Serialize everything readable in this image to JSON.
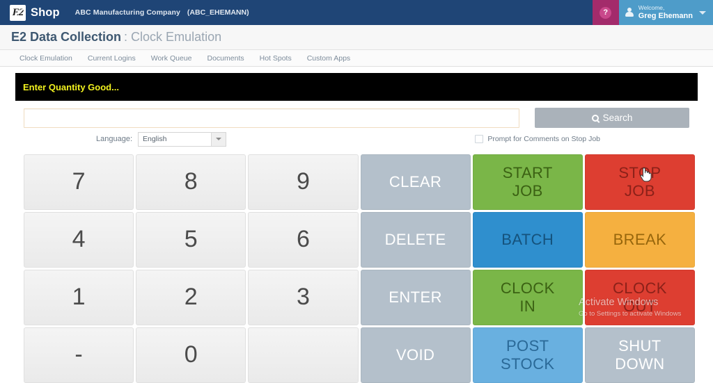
{
  "topbar": {
    "logo_text": "E2",
    "logo_icon": "e2-shop-logo-icon",
    "brand": "Shop",
    "company": "ABC Manufacturing Company",
    "company_code": "(ABC_EHEMANN)",
    "help_icon": "question-mark-icon",
    "help_glyph": "?",
    "avatar_icon": "user-avatar-icon",
    "welcome_label": "Welcome,",
    "user_name": "Greg Ehemann",
    "caret_icon": "chevron-down-icon",
    "help_bg": "#a32b6b",
    "user_bg": "#4e9cc9",
    "bar_bg": "#1f4576"
  },
  "page": {
    "title": "E2 Data Collection",
    "subtitle": ": Clock Emulation"
  },
  "tabs": [
    {
      "label": "Clock Emulation"
    },
    {
      "label": "Current Logins"
    },
    {
      "label": "Work Queue"
    },
    {
      "label": "Documents"
    },
    {
      "label": "Hot Spots"
    },
    {
      "label": "Custom Apps"
    }
  ],
  "banner": {
    "text": "Enter Quantity Good...",
    "text_color": "#f2f21f",
    "bg_color": "#000000"
  },
  "search": {
    "value": "",
    "placeholder": "",
    "button_label": "Search",
    "button_icon": "search-icon"
  },
  "options": {
    "language_label": "Language:",
    "language_value": "English",
    "language_caret_icon": "chevron-down-icon",
    "prompt_checkbox_label": "Prompt for Comments on Stop Job",
    "prompt_checkbox_checked": false
  },
  "keypad": {
    "rows": [
      [
        {
          "label": "7",
          "kind": "num",
          "name": "key-7"
        },
        {
          "label": "8",
          "kind": "num",
          "name": "key-8"
        },
        {
          "label": "9",
          "kind": "num",
          "name": "key-9"
        },
        {
          "label": "CLEAR",
          "kind": "gray",
          "name": "key-clear"
        },
        {
          "label": "START\nJOB",
          "kind": "green",
          "name": "key-start-job"
        },
        {
          "label": "STOP\nJOB",
          "kind": "red",
          "name": "key-stop-job"
        }
      ],
      [
        {
          "label": "4",
          "kind": "num",
          "name": "key-4"
        },
        {
          "label": "5",
          "kind": "num",
          "name": "key-5"
        },
        {
          "label": "6",
          "kind": "num",
          "name": "key-6"
        },
        {
          "label": "DELETE",
          "kind": "gray",
          "name": "key-delete"
        },
        {
          "label": "BATCH",
          "kind": "blue",
          "name": "key-batch"
        },
        {
          "label": "BREAK",
          "kind": "orange",
          "name": "key-break"
        }
      ],
      [
        {
          "label": "1",
          "kind": "num",
          "name": "key-1"
        },
        {
          "label": "2",
          "kind": "num",
          "name": "key-2"
        },
        {
          "label": "3",
          "kind": "num",
          "name": "key-3"
        },
        {
          "label": "ENTER",
          "kind": "gray",
          "name": "key-enter"
        },
        {
          "label": "CLOCK\nIN",
          "kind": "green",
          "name": "key-clock-in"
        },
        {
          "label": "CLOCK\nOUT",
          "kind": "red",
          "name": "key-clock-out"
        }
      ],
      [
        {
          "label": "-",
          "kind": "num",
          "name": "key-minus"
        },
        {
          "label": "0",
          "kind": "num",
          "name": "key-0"
        },
        {
          "label": "",
          "kind": "num",
          "name": "key-decimal"
        },
        {
          "label": "VOID",
          "kind": "gray",
          "name": "key-void"
        },
        {
          "label": "POST\nSTOCK",
          "kind": "ltblue",
          "name": "key-post-stock"
        },
        {
          "label": "SHUT\nDOWN",
          "kind": "gray",
          "name": "key-shut-down"
        }
      ]
    ]
  },
  "watermark": {
    "title": "Activate Windows",
    "subtitle": "Go to Settings to activate Windows"
  },
  "cursor": {
    "icon": "pointing-hand-cursor-icon"
  }
}
